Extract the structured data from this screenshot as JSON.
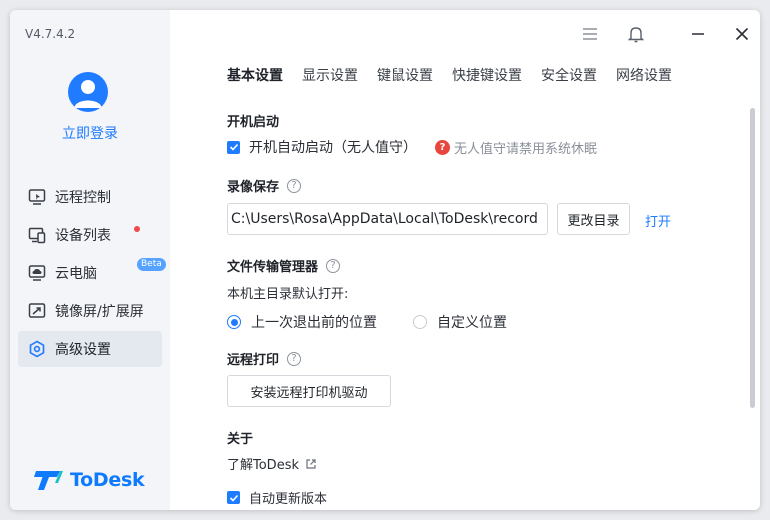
{
  "app": {
    "version": "V4.7.4.2",
    "brand": "ToDesk",
    "login_label": "立即登录"
  },
  "sidebar": {
    "items": [
      {
        "label": "远程控制",
        "icon": "remote-control-icon"
      },
      {
        "label": "设备列表",
        "icon": "device-list-icon",
        "badge": "red-dot"
      },
      {
        "label": "云电脑",
        "icon": "cloud-pc-icon",
        "badge_text": "Beta"
      },
      {
        "label": "镜像屏/扩展屏",
        "icon": "mirror-screen-icon"
      },
      {
        "label": "高级设置",
        "icon": "advanced-settings-icon",
        "active": true
      }
    ]
  },
  "tabs": [
    {
      "label": "基本设置",
      "active": true
    },
    {
      "label": "显示设置"
    },
    {
      "label": "键鼠设置"
    },
    {
      "label": "快捷键设置"
    },
    {
      "label": "安全设置"
    },
    {
      "label": "网络设置"
    }
  ],
  "settings": {
    "startup": {
      "title": "开机启动",
      "auto_start_label": "开机自动启动（无人值守）",
      "auto_start_checked": true,
      "warning": "无人值守请禁用系统休眠"
    },
    "recording": {
      "title": "录像保存",
      "help": "?",
      "path": "C:\\Users\\Rosa\\AppData\\Local\\ToDesk\\record",
      "change_dir_label": "更改目录",
      "open_label": "打开"
    },
    "file_transfer": {
      "title": "文件传输管理器",
      "help": "?",
      "default_open_label": "本机主目录默认打开:",
      "options": [
        {
          "label": "上一次退出前的位置",
          "selected": true
        },
        {
          "label": "自定义位置",
          "selected": false
        }
      ]
    },
    "remote_print": {
      "title": "远程打印",
      "help": "?",
      "install_label": "安装远程打印机驱动"
    },
    "about": {
      "title": "关于",
      "learn_more": "了解ToDesk",
      "auto_update_label": "自动更新版本",
      "auto_update_checked": true
    }
  },
  "colors": {
    "accent": "#1f7bff",
    "sidebar_bg": "#f3f5f8",
    "warning": "#e8453c"
  }
}
